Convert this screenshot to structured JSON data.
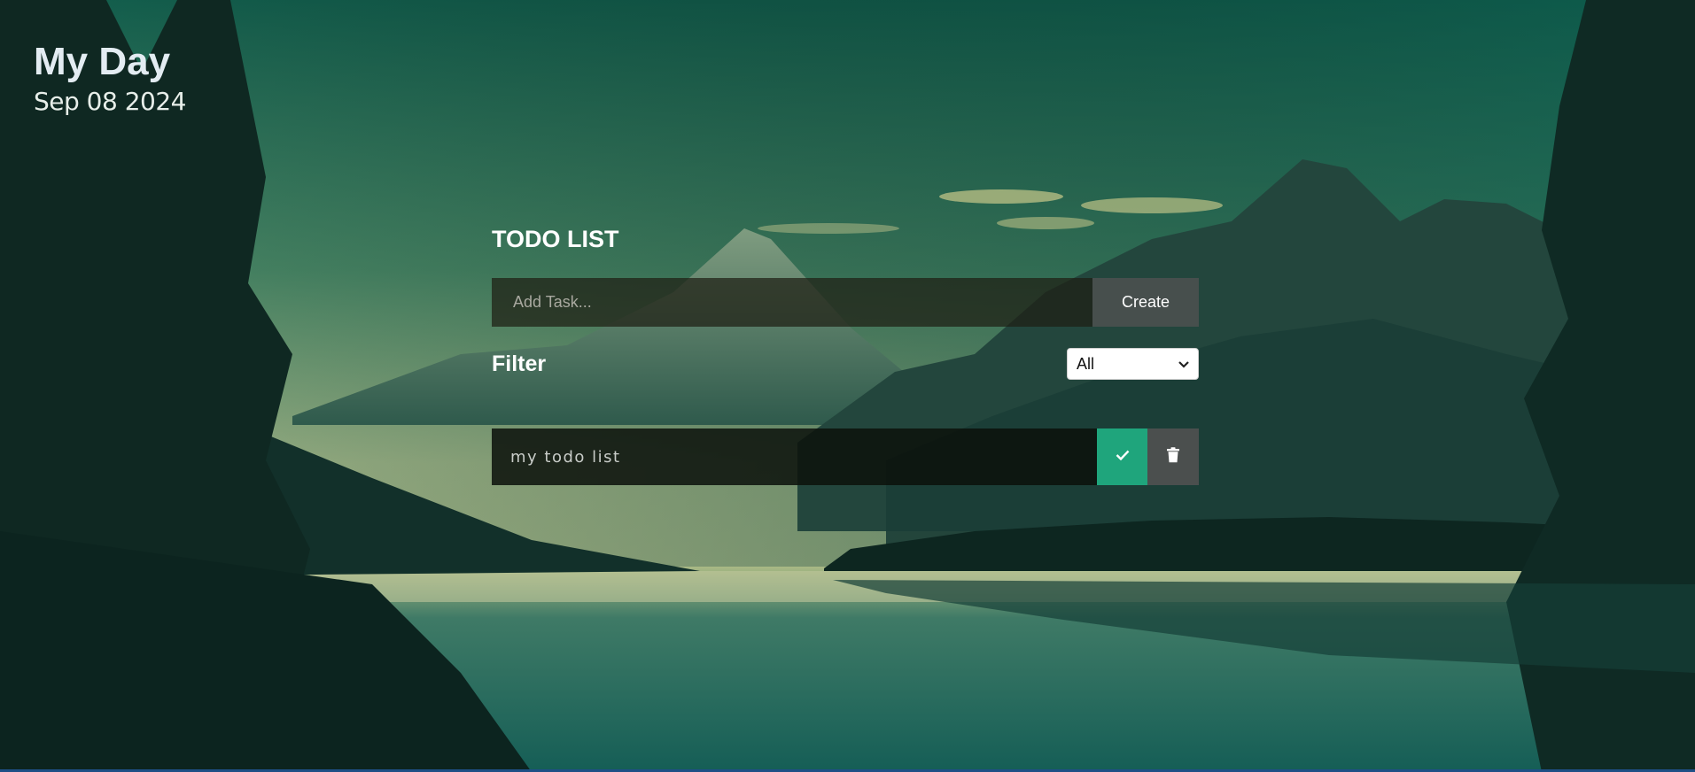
{
  "header": {
    "title": "My Day",
    "date": "Sep 08 2024"
  },
  "todo": {
    "title": "TODO LIST",
    "input": {
      "placeholder": "Add Task...",
      "value": ""
    },
    "create_label": "Create",
    "filter": {
      "label": "Filter",
      "selected": "All"
    },
    "tasks": [
      {
        "text": "my todo list",
        "completed": false
      }
    ]
  },
  "icons": {
    "complete": "check-icon",
    "delete": "trash-icon",
    "select": "chevron-down-icon"
  },
  "colors": {
    "complete_button": "#1fa57c",
    "delete_button": "#4b4f4e",
    "create_button": "#4b504e",
    "date_text": "#e7eee9"
  }
}
